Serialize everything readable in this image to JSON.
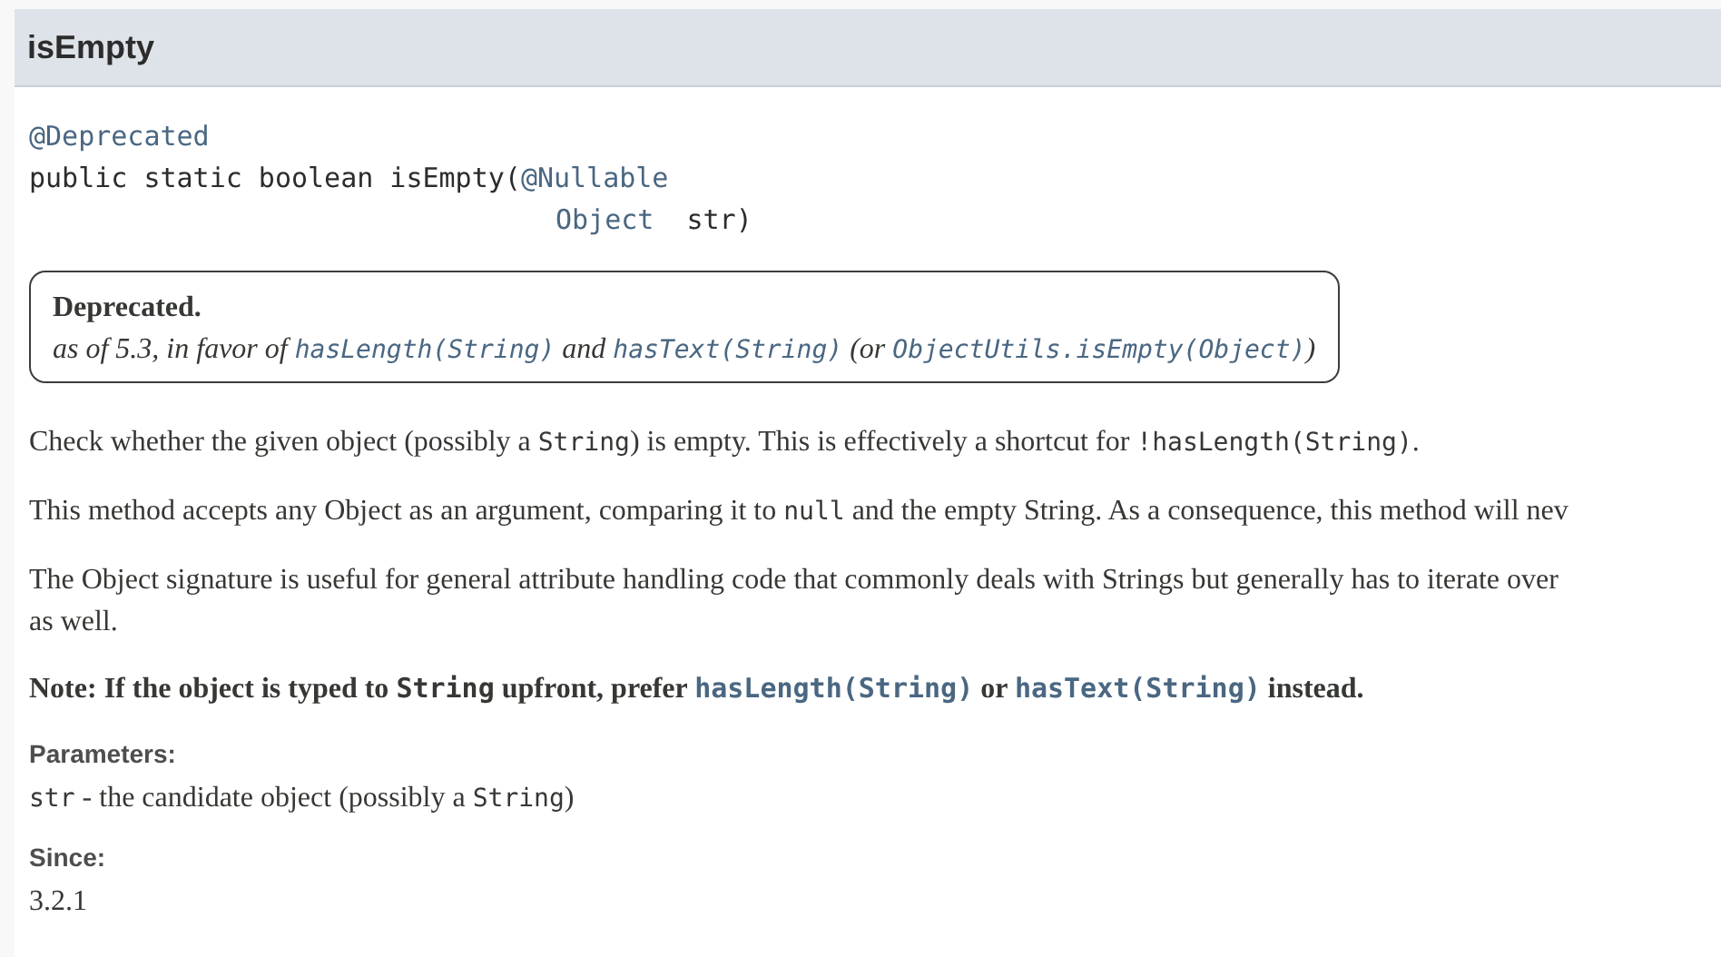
{
  "header": {
    "title": "isEmpty"
  },
  "signature": {
    "annotation": "@Deprecated",
    "modifiers": "public static boolean isEmpty(",
    "param_annotation": "@Nullable",
    "param_type": "Object",
    "param_name": "str)"
  },
  "deprecation": {
    "label": "Deprecated.",
    "segments": [
      {
        "kind": "plain",
        "text": "as of 5.3, in favor of "
      },
      {
        "kind": "link",
        "text": "hasLength(String)"
      },
      {
        "kind": "plain",
        "text": " and "
      },
      {
        "kind": "link",
        "text": "hasText(String)"
      },
      {
        "kind": "plain",
        "text": " (or "
      },
      {
        "kind": "link",
        "text": "ObjectUtils.isEmpty(Object)"
      },
      {
        "kind": "plain",
        "text": ")"
      }
    ]
  },
  "paragraphs": [
    {
      "bold": false,
      "lines": [
        [
          {
            "kind": "plain",
            "text": "Check whether the given object (possibly a "
          },
          {
            "kind": "code",
            "text": "String"
          },
          {
            "kind": "plain",
            "text": ") is empty. This is effectively a shortcut for "
          },
          {
            "kind": "code",
            "text": "!hasLength(String)"
          },
          {
            "kind": "plain",
            "text": "."
          }
        ]
      ]
    },
    {
      "bold": false,
      "lines": [
        [
          {
            "kind": "plain",
            "text": "This method accepts any Object as an argument, comparing it to "
          },
          {
            "kind": "code",
            "text": "null"
          },
          {
            "kind": "plain",
            "text": " and the empty String. As a consequence, this method will nev"
          }
        ]
      ]
    },
    {
      "bold": false,
      "lines": [
        [
          {
            "kind": "plain",
            "text": "The Object signature is useful for general attribute handling code that commonly deals with Strings but generally has to iterate over"
          }
        ],
        [
          {
            "kind": "plain",
            "text": "as well."
          }
        ]
      ]
    },
    {
      "bold": true,
      "lines": [
        [
          {
            "kind": "plain",
            "text": "Note: If the object is typed to "
          },
          {
            "kind": "code",
            "text": "String"
          },
          {
            "kind": "plain",
            "text": " upfront, prefer "
          },
          {
            "kind": "link",
            "text": "hasLength(String)"
          },
          {
            "kind": "plain",
            "text": " or "
          },
          {
            "kind": "link",
            "text": "hasText(String)"
          },
          {
            "kind": "plain",
            "text": " instead."
          }
        ]
      ]
    }
  ],
  "details": [
    {
      "term": "Parameters:",
      "segments": [
        {
          "kind": "code",
          "text": "str"
        },
        {
          "kind": "plain",
          "text": " - the candidate object (possibly a "
        },
        {
          "kind": "code",
          "text": "String"
        },
        {
          "kind": "plain",
          "text": ")"
        }
      ]
    },
    {
      "term": "Since:",
      "segments": [
        {
          "kind": "plain",
          "text": "3.2.1"
        }
      ]
    }
  ]
}
